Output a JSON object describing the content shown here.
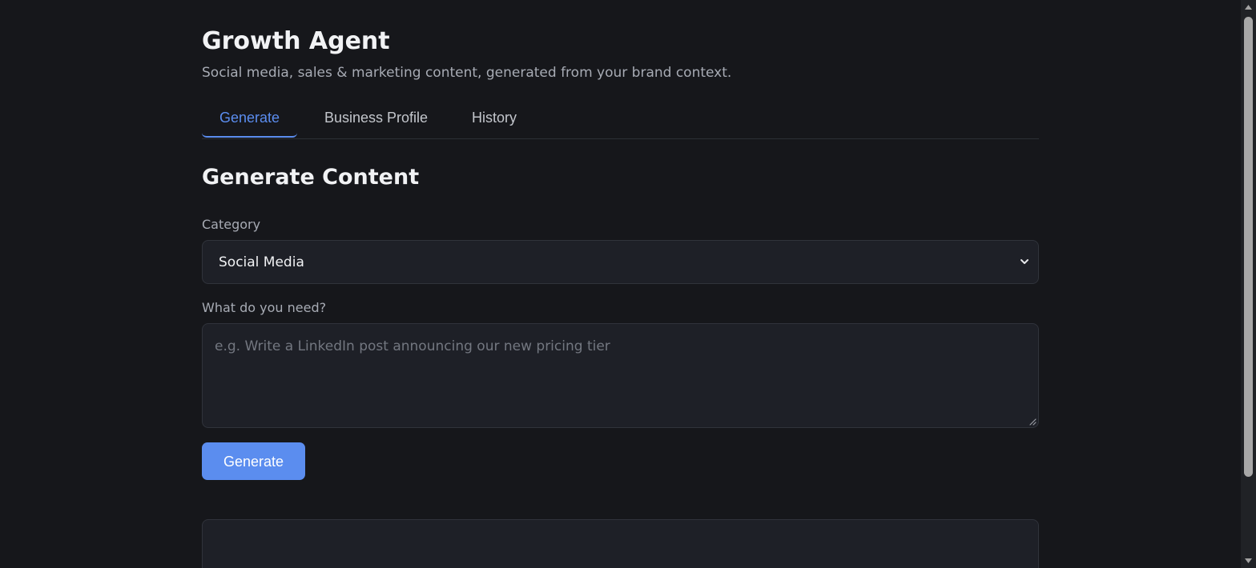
{
  "header": {
    "title": "Growth Agent",
    "subtitle": "Social media, sales & marketing content, generated from your brand context."
  },
  "tabs": [
    {
      "label": "Generate",
      "active": true
    },
    {
      "label": "Business Profile",
      "active": false
    },
    {
      "label": "History",
      "active": false
    }
  ],
  "form": {
    "section_title": "Generate Content",
    "category_label": "Category",
    "category_value": "Social Media",
    "need_label": "What do you need?",
    "need_placeholder": "e.g. Write a LinkedIn post announcing our new pricing tier",
    "generate_label": "Generate"
  },
  "icons": {
    "select": "chevron-down-icon",
    "textarea": "resize-handle-icon"
  },
  "colors": {
    "background": "#16171b",
    "surface": "#1e2027",
    "accent": "#5b8def",
    "muted_text": "#a7abb4"
  }
}
